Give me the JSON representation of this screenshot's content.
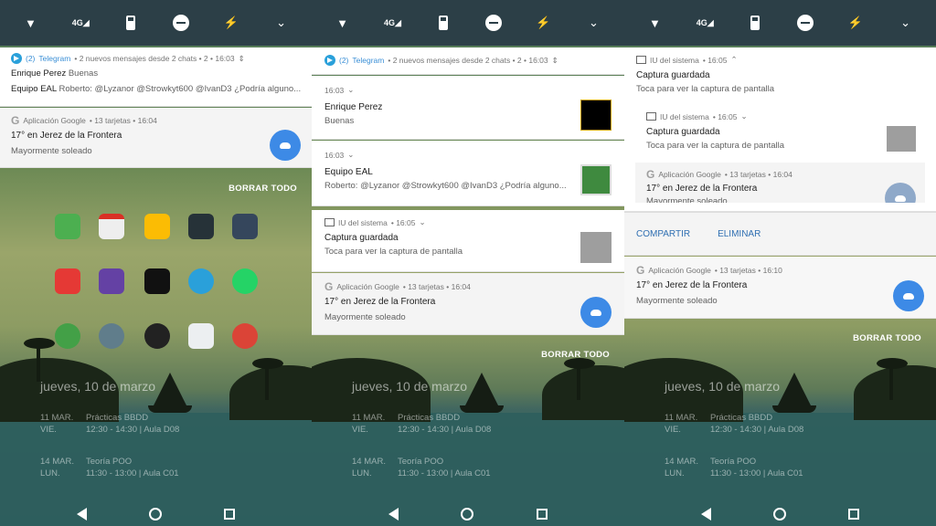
{
  "status": {
    "lte": "4G"
  },
  "home": {
    "date": "jueves, 10 de marzo",
    "events": [
      {
        "day": "11 MAR.",
        "dow": "VIE.",
        "title": "Prácticas BBDD",
        "time": "12:30 - 14:30  |  Aula D08"
      },
      {
        "day": "14 MAR.",
        "dow": "LUN.",
        "title": "Teoría POO",
        "time": "11:30 - 13:00  |  Aula C01"
      }
    ],
    "clear_all": "BORRAR TODO"
  },
  "telegram": {
    "count": "(2)",
    "app": "Telegram",
    "summary": "• 2 nuevos mensajes desde 2 chats • 2 • 16:03",
    "line1_name": "Enrique Perez",
    "line1_msg": "Buenas",
    "line2_name": "Equipo EAL",
    "line2_msg": "Roberto: @Lyzanor @Strowkyt600 @IvanD3 ¿Podría alguno...",
    "msg_time": "16:03"
  },
  "google": {
    "app": "Aplicación Google",
    "meta": "• 13 tarjetas • 16:04",
    "meta_b": "• 13 tarjetas • 16:10",
    "title": "17° en Jerez de la Frontera",
    "subtitle": "Mayormente soleado"
  },
  "system": {
    "app": "IU del sistema",
    "meta": "• 16:05",
    "title": "Captura guardada",
    "subtitle": "Toca para ver la captura de pantalla"
  },
  "actions": {
    "share": "COMPARTIR",
    "delete": "ELIMINAR"
  }
}
